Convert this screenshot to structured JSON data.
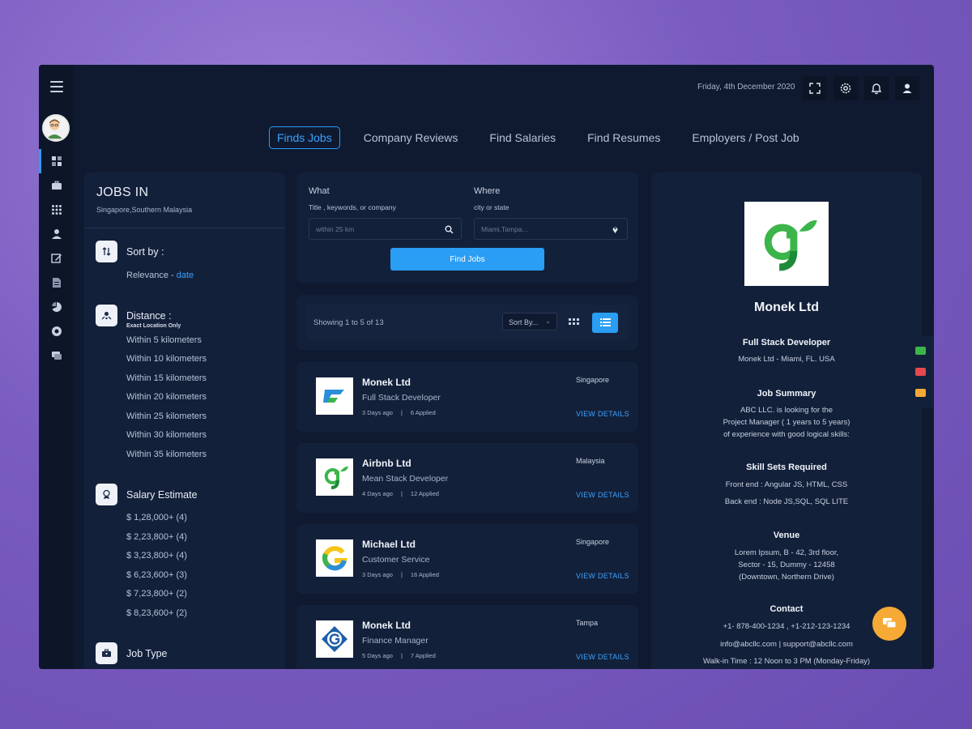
{
  "colors": {
    "accent": "#2a9df4",
    "background": "#0f1a30",
    "panel": "#13203a",
    "fab": "#f7a936"
  },
  "topbar": {
    "date": "Friday, 4th December 2020",
    "icons": [
      "fullscreen-icon",
      "gear-icon",
      "bell-icon",
      "user-icon"
    ]
  },
  "sidebar": {
    "icons": [
      "menu-icon",
      "dashboard-icon",
      "briefcase-icon",
      "apps-icon",
      "user-icon",
      "edit-icon",
      "document-icon",
      "chart-icon",
      "settings-icon",
      "chat-icon"
    ]
  },
  "nav": {
    "tabs": [
      {
        "label": "Finds Jobs",
        "active": true
      },
      {
        "label": "Company Reviews"
      },
      {
        "label": "Find Salaries"
      },
      {
        "label": "Find Resumes"
      },
      {
        "label": "Employers / Post Job"
      }
    ]
  },
  "filters": {
    "title": "JOBS IN",
    "subtitle": "Singapore,Southern Malaysia",
    "sort": {
      "title": "Sort by :",
      "relevance": "Relevance - ",
      "date": "date"
    },
    "distance": {
      "title": "Distance :",
      "sub": "Exact Location Only",
      "options": [
        "Within 5 kilometers",
        "Within 10 kilometers",
        "Within 15 kilometers",
        "Within 20 kilometers",
        "Within 25 kilometers",
        "Within 30 kilometers",
        "Within 35 kilometers"
      ]
    },
    "salary": {
      "title": "Salary Estimate",
      "options": [
        "$ 1,28,000+ (4)",
        "$ 2,23,800+ (4)",
        "$ 3,23,800+ (4)",
        "$ 6,23,600+ (3)",
        "$ 7,23,800+ (2)",
        "$ 8,23,600+ (2)"
      ]
    },
    "jobtype": {
      "title": "Job Type"
    }
  },
  "search": {
    "what_label": "What",
    "what_sub": "Title , keywords, or company",
    "what_placeholder": "within 25 km",
    "where_label": "Where",
    "where_sub": "city or state",
    "where_placeholder": "Miami,Tampa...",
    "button": "Find Jobs"
  },
  "results": {
    "count": "Showing 1 to 5 of 13",
    "sort_label": "Sort By..."
  },
  "jobs": [
    {
      "company": "Monek Ltd",
      "role": "Full Stack Developer",
      "ago": "3 Days ago",
      "applied": "6 Applied",
      "location": "Singapore",
      "action": "VIEW DETAILS"
    },
    {
      "company": "Airbnb Ltd",
      "role": "Mean Stack Developer",
      "ago": "4 Days ago",
      "applied": "12 Applied",
      "location": "Malaysia",
      "action": "VIEW DETAILS"
    },
    {
      "company": "Michael Ltd",
      "role": "Customer Service",
      "ago": "3 Days ago",
      "applied": "16 Applied",
      "location": "Singapore",
      "action": "VIEW DETAILS"
    },
    {
      "company": "Monek Ltd",
      "role": "Finance Manager",
      "ago": "5 Days ago",
      "applied": "7 Applied",
      "location": "Tampa",
      "action": "VIEW DETAILS"
    }
  ],
  "detail": {
    "company": "Monek Ltd",
    "position": "Full Stack Developer",
    "location": "Monek Ltd - Miami, FL. USA",
    "summary_title": "Job Summary",
    "summary": [
      "ABC LLC. is looking for the",
      "Project Manager ( 1 years to 5 years)",
      "of experience with good logical skills:"
    ],
    "skills_title": "Skill Sets Required",
    "skills": [
      "Front end : Angular JS, HTML, CSS",
      "Back end : Node JS,SQL, SQL LITE"
    ],
    "venue_title": "Venue",
    "venue": [
      "Lorem Ipsum, B - 42, 3rd floor,",
      "Sector - 15, Dummy - 12458",
      "(Downtown, Northern Drive)"
    ],
    "contact_title": "Contact",
    "contact": [
      "+1- 878-400-1234 , +1-212-123-1234",
      "info@abcllc.com | support@abcllc.com",
      "Walk-in Time : 12 Noon to 3 PM (Monday-Friday)"
    ]
  }
}
